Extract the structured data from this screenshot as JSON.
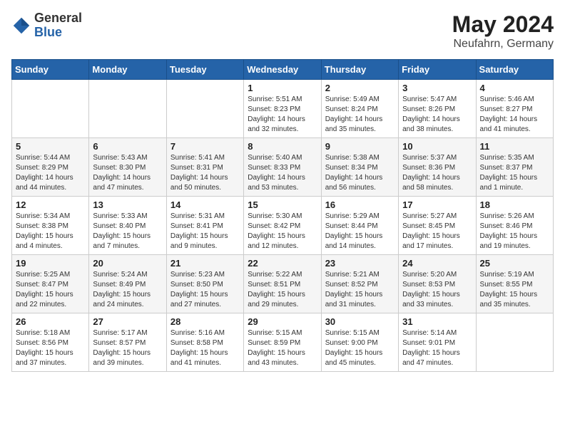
{
  "header": {
    "logo_general": "General",
    "logo_blue": "Blue",
    "title": "May 2024",
    "location": "Neufahrn, Germany"
  },
  "weekdays": [
    "Sunday",
    "Monday",
    "Tuesday",
    "Wednesday",
    "Thursday",
    "Friday",
    "Saturday"
  ],
  "weeks": [
    [
      {
        "day": "",
        "info": ""
      },
      {
        "day": "",
        "info": ""
      },
      {
        "day": "",
        "info": ""
      },
      {
        "day": "1",
        "info": "Sunrise: 5:51 AM\nSunset: 8:23 PM\nDaylight: 14 hours\nand 32 minutes."
      },
      {
        "day": "2",
        "info": "Sunrise: 5:49 AM\nSunset: 8:24 PM\nDaylight: 14 hours\nand 35 minutes."
      },
      {
        "day": "3",
        "info": "Sunrise: 5:47 AM\nSunset: 8:26 PM\nDaylight: 14 hours\nand 38 minutes."
      },
      {
        "day": "4",
        "info": "Sunrise: 5:46 AM\nSunset: 8:27 PM\nDaylight: 14 hours\nand 41 minutes."
      }
    ],
    [
      {
        "day": "5",
        "info": "Sunrise: 5:44 AM\nSunset: 8:29 PM\nDaylight: 14 hours\nand 44 minutes."
      },
      {
        "day": "6",
        "info": "Sunrise: 5:43 AM\nSunset: 8:30 PM\nDaylight: 14 hours\nand 47 minutes."
      },
      {
        "day": "7",
        "info": "Sunrise: 5:41 AM\nSunset: 8:31 PM\nDaylight: 14 hours\nand 50 minutes."
      },
      {
        "day": "8",
        "info": "Sunrise: 5:40 AM\nSunset: 8:33 PM\nDaylight: 14 hours\nand 53 minutes."
      },
      {
        "day": "9",
        "info": "Sunrise: 5:38 AM\nSunset: 8:34 PM\nDaylight: 14 hours\nand 56 minutes."
      },
      {
        "day": "10",
        "info": "Sunrise: 5:37 AM\nSunset: 8:36 PM\nDaylight: 14 hours\nand 58 minutes."
      },
      {
        "day": "11",
        "info": "Sunrise: 5:35 AM\nSunset: 8:37 PM\nDaylight: 15 hours\nand 1 minute."
      }
    ],
    [
      {
        "day": "12",
        "info": "Sunrise: 5:34 AM\nSunset: 8:38 PM\nDaylight: 15 hours\nand 4 minutes."
      },
      {
        "day": "13",
        "info": "Sunrise: 5:33 AM\nSunset: 8:40 PM\nDaylight: 15 hours\nand 7 minutes."
      },
      {
        "day": "14",
        "info": "Sunrise: 5:31 AM\nSunset: 8:41 PM\nDaylight: 15 hours\nand 9 minutes."
      },
      {
        "day": "15",
        "info": "Sunrise: 5:30 AM\nSunset: 8:42 PM\nDaylight: 15 hours\nand 12 minutes."
      },
      {
        "day": "16",
        "info": "Sunrise: 5:29 AM\nSunset: 8:44 PM\nDaylight: 15 hours\nand 14 minutes."
      },
      {
        "day": "17",
        "info": "Sunrise: 5:27 AM\nSunset: 8:45 PM\nDaylight: 15 hours\nand 17 minutes."
      },
      {
        "day": "18",
        "info": "Sunrise: 5:26 AM\nSunset: 8:46 PM\nDaylight: 15 hours\nand 19 minutes."
      }
    ],
    [
      {
        "day": "19",
        "info": "Sunrise: 5:25 AM\nSunset: 8:47 PM\nDaylight: 15 hours\nand 22 minutes."
      },
      {
        "day": "20",
        "info": "Sunrise: 5:24 AM\nSunset: 8:49 PM\nDaylight: 15 hours\nand 24 minutes."
      },
      {
        "day": "21",
        "info": "Sunrise: 5:23 AM\nSunset: 8:50 PM\nDaylight: 15 hours\nand 27 minutes."
      },
      {
        "day": "22",
        "info": "Sunrise: 5:22 AM\nSunset: 8:51 PM\nDaylight: 15 hours\nand 29 minutes."
      },
      {
        "day": "23",
        "info": "Sunrise: 5:21 AM\nSunset: 8:52 PM\nDaylight: 15 hours\nand 31 minutes."
      },
      {
        "day": "24",
        "info": "Sunrise: 5:20 AM\nSunset: 8:53 PM\nDaylight: 15 hours\nand 33 minutes."
      },
      {
        "day": "25",
        "info": "Sunrise: 5:19 AM\nSunset: 8:55 PM\nDaylight: 15 hours\nand 35 minutes."
      }
    ],
    [
      {
        "day": "26",
        "info": "Sunrise: 5:18 AM\nSunset: 8:56 PM\nDaylight: 15 hours\nand 37 minutes."
      },
      {
        "day": "27",
        "info": "Sunrise: 5:17 AM\nSunset: 8:57 PM\nDaylight: 15 hours\nand 39 minutes."
      },
      {
        "day": "28",
        "info": "Sunrise: 5:16 AM\nSunset: 8:58 PM\nDaylight: 15 hours\nand 41 minutes."
      },
      {
        "day": "29",
        "info": "Sunrise: 5:15 AM\nSunset: 8:59 PM\nDaylight: 15 hours\nand 43 minutes."
      },
      {
        "day": "30",
        "info": "Sunrise: 5:15 AM\nSunset: 9:00 PM\nDaylight: 15 hours\nand 45 minutes."
      },
      {
        "day": "31",
        "info": "Sunrise: 5:14 AM\nSunset: 9:01 PM\nDaylight: 15 hours\nand 47 minutes."
      },
      {
        "day": "",
        "info": ""
      }
    ]
  ]
}
